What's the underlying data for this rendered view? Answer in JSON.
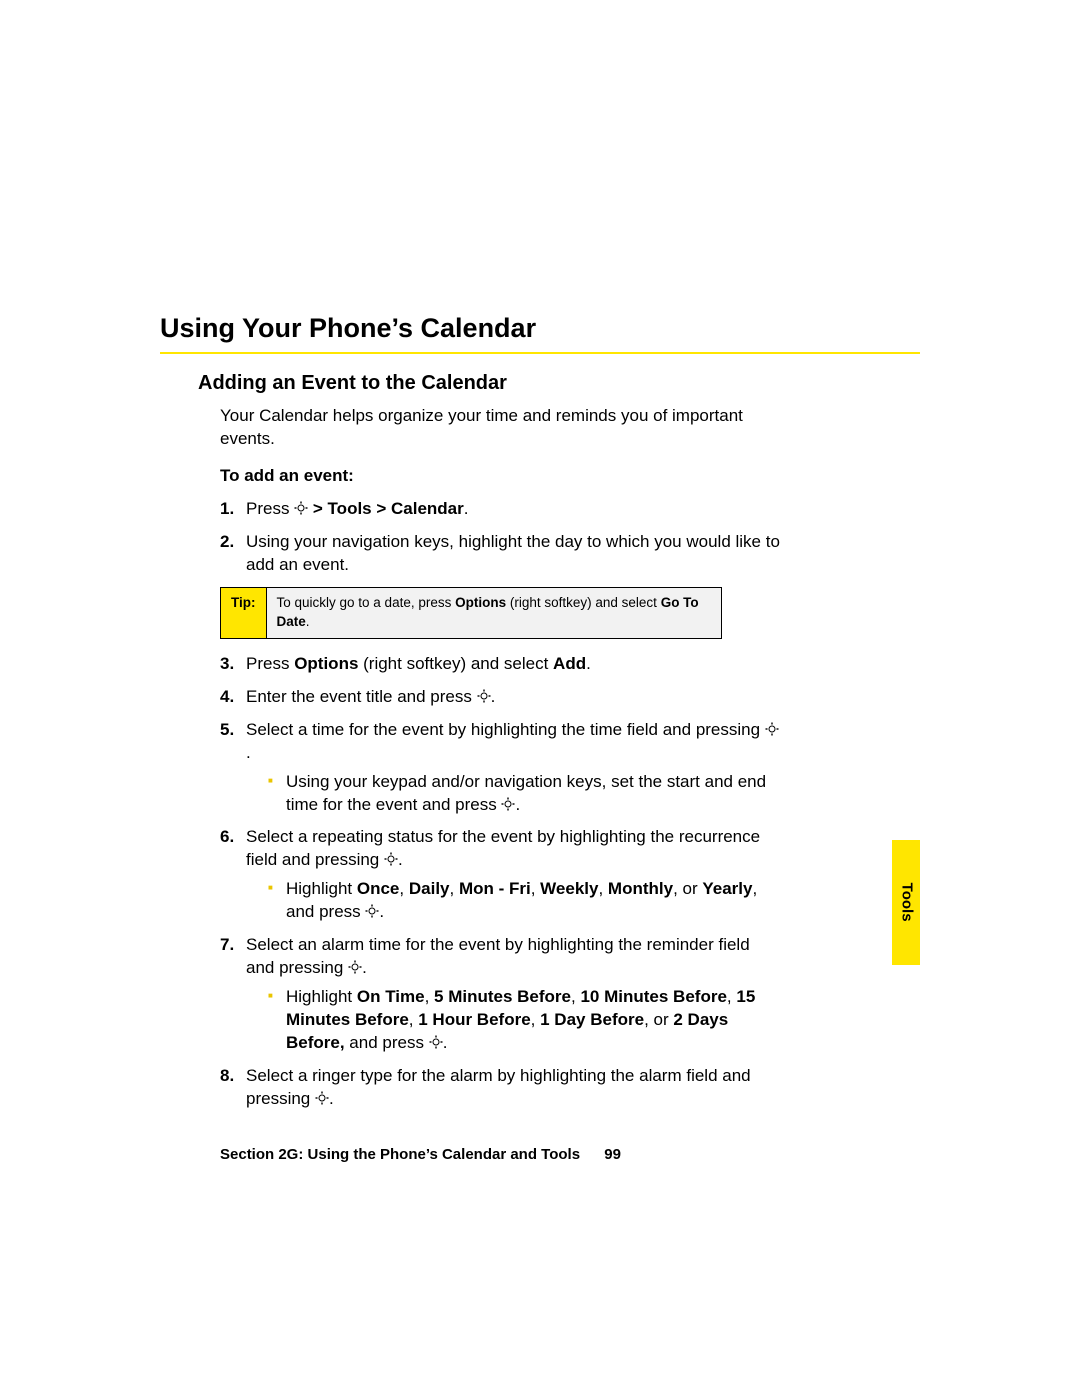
{
  "heading": "Using Your Phone’s Calendar",
  "subheading": "Adding an Event to the Calendar",
  "intro": "Your Calendar helps organize your time and reminds you of important events.",
  "subhead": "To add an event:",
  "steps": {
    "s1_a": "Press ",
    "s1_b": " > Tools > Calendar",
    "s1_c": ".",
    "s2": "Using your navigation keys, highlight the day to which you would like to add an event.",
    "s3_a": "Press ",
    "s3_b": "Options",
    "s3_c": " (right softkey) and select ",
    "s3_d": "Add",
    "s3_e": ".",
    "s4_a": "Enter the event title and press ",
    "s5_a": "Select a time for the event by highlighting the time field and pressing ",
    "s5_sub_a": "Using your keypad and/or navigation keys, set the start and end time for the event and press ",
    "s6_a": "Select a repeating status for the event by highlighting the recurrence field and pressing ",
    "s6_sub_a": "Highlight ",
    "s6_sub_b": "Once",
    "s6_sub_c": ", ",
    "s6_sub_d": "Daily",
    "s6_sub_e": ", ",
    "s6_sub_f": "Mon - Fri",
    "s6_sub_g": ", ",
    "s6_sub_h": "Weekly",
    "s6_sub_i": ", ",
    "s6_sub_j": "Monthly",
    "s6_sub_k": ", or ",
    "s6_sub_l": "Yearly",
    "s6_sub_m": ", and press ",
    "s7_a": "Select an alarm time for the event by highlighting the reminder field and pressing ",
    "s7_sub_a": "Highlight ",
    "s7_sub_b": "On Time",
    "s7_sub_c": ", ",
    "s7_sub_d": "5 Minutes Before",
    "s7_sub_e": ", ",
    "s7_sub_f": "10 Minutes Before",
    "s7_sub_g": ", ",
    "s7_sub_h": "15 Minutes Before",
    "s7_sub_i": ", ",
    "s7_sub_j": "1 Hour Before",
    "s7_sub_k": ", ",
    "s7_sub_l": "1 Day Before",
    "s7_sub_m": ", or ",
    "s7_sub_n": "2 Days Before,",
    "s7_sub_o": " and press ",
    "s8_a": "Select a ringer type for the alarm by highlighting the alarm field and pressing "
  },
  "tip": {
    "label": "Tip:",
    "a": "To quickly go to a date, press ",
    "b": "Options",
    "c": " (right softkey) and select ",
    "d": "Go To Date",
    "e": "."
  },
  "footer": {
    "section": "Section 2G: Using the Phone’s Calendar and Tools",
    "page": "99"
  },
  "sidetab": "Tools",
  "period": "."
}
